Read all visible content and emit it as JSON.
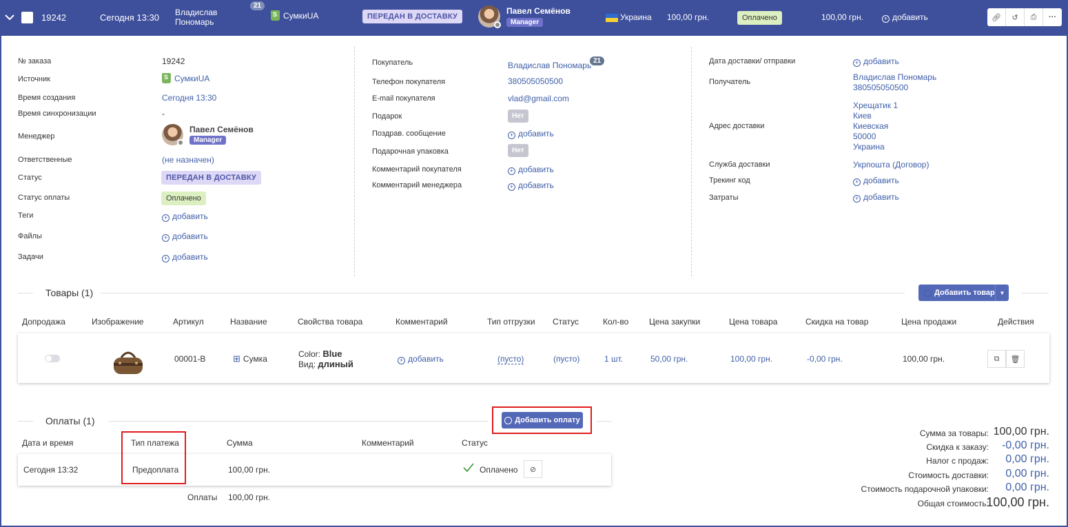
{
  "header": {
    "order_id": "19242",
    "created": "Сегодня 13:30",
    "customer_line1": "Владислав",
    "customer_line2": "Пономарь",
    "customer_badge": "21",
    "source": "СумкиUA",
    "status": "ПЕРЕДАН В ДОСТАВКУ",
    "manager_name": "Павел Семёнов",
    "manager_role": "Manager",
    "country": "Украина",
    "total": "100,00 грн.",
    "payment_status": "Оплачено",
    "paid_amount": "100,00 грн.",
    "add_label": "добавить"
  },
  "left": {
    "order_no_label": "№ заказа",
    "order_no": "19242",
    "source_label": "Источник",
    "source": "СумкиUA",
    "created_label": "Время создания",
    "created": "Сегодня 13:30",
    "sync_label": "Время синхронизации",
    "sync": "-",
    "manager_label": "Менеджер",
    "manager_name": "Павел Семёнов",
    "manager_role": "Manager",
    "responsible_label": "Ответственные",
    "responsible": "(не назначен)",
    "status_label": "Статус",
    "status": "ПЕРЕДАН В ДОСТАВКУ",
    "pay_status_label": "Статус оплаты",
    "pay_status": "Оплачено",
    "tags_label": "Теги",
    "files_label": "Файлы",
    "tasks_label": "Задачи",
    "add": "добавить"
  },
  "middle": {
    "buyer_label": "Покупатель",
    "buyer": "Владислав Пономарь",
    "buyer_badge": "21",
    "phone_label": "Телефон покупателя",
    "phone": "380505050500",
    "email_label": "E-mail покупателя",
    "email": "vlad@gmail.com",
    "gift_label": "Подарок",
    "gift": "Нет",
    "greeting_label": "Поздрав. сообщение",
    "wrap_label": "Подарочная упаковка",
    "wrap": "Нет",
    "buyer_comment_label": "Комментарий покупателя",
    "manager_comment_label": "Комментарий менеджера",
    "add": "добавить"
  },
  "right": {
    "delivery_date_label": "Дата доставки/ отправки",
    "recipient_label": "Получатель",
    "recipient_name": "Владислав Пономарь",
    "recipient_phone": "380505050500",
    "address_label": "Адрес доставки",
    "address": [
      "Хрещатик 1",
      "Киев",
      "Киевская",
      "50000",
      "Украина"
    ],
    "service_label": "Служба доставки",
    "service": "Укрпошта (Договор)",
    "tracking_label": "Трекинг код",
    "costs_label": "Затраты",
    "add": "добавить"
  },
  "goods": {
    "title": "Товары (1)",
    "add_button": "Добавить товар",
    "columns": [
      "Допродажа",
      "Изображение",
      "Артикул",
      "Название",
      "Свойства товара",
      "Комментарий",
      "Тип отгрузки",
      "Статус",
      "Кол-во",
      "Цена закупки",
      "Цена товара",
      "Скидка на товар",
      "Цена продажи",
      "Действия"
    ],
    "row": {
      "sku": "00001-B",
      "name": "Сумка",
      "prop1_label": "Color:",
      "prop1_value": "Blue",
      "prop2_label": "Вид:",
      "prop2_value": "длиный",
      "comment_add": "добавить",
      "shipment_type": "(пусто)",
      "status": "(пусто)",
      "qty": "1 шт.",
      "purchase_price": "50,00 грн.",
      "price": "100,00 грн.",
      "discount": "-0,00 грн.",
      "sale_price": "100,00 грн."
    }
  },
  "payments": {
    "title": "Оплаты (1)",
    "add_button": "Добавить оплату",
    "columns": [
      "Дата и время",
      "Тип платежа",
      "Сумма",
      "Комментарий",
      "Статус"
    ],
    "row": {
      "datetime": "Сегодня 13:32",
      "type": "Предоплата",
      "amount": "100,00 грн.",
      "status": "Оплачено"
    },
    "footer_label": "Оплаты",
    "footer_value": "100,00 грн."
  },
  "summary": [
    {
      "label": "Сумма за товары:",
      "value": "100,00 грн."
    },
    {
      "label": "Скидка к заказу:",
      "value": "-0,00 грн."
    },
    {
      "label": "Налог с продаж:",
      "value": "0,00 грн."
    },
    {
      "label": "Стоимость доставки:",
      "value": "0,00 грн."
    },
    {
      "label": "Стоимость подарочной упаковки:",
      "value": "0,00 грн."
    },
    {
      "label": "Общая стоимость:",
      "value": "100,00 грн."
    }
  ],
  "colors": {
    "header_bg": "#3e4f9c",
    "link": "#3f5fa8",
    "button": "#5468b8",
    "highlight": "#e01b1b"
  }
}
